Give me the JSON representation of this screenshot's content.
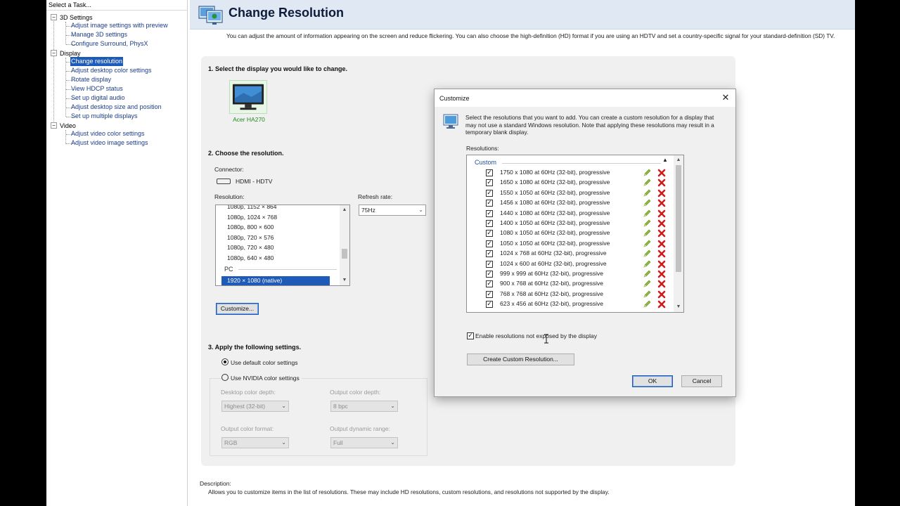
{
  "task_panel": {
    "header": "Select a Task...",
    "categories": [
      {
        "label": "3D Settings",
        "items": [
          "Adjust image settings with preview",
          "Manage 3D settings",
          "Configure Surround, PhysX"
        ]
      },
      {
        "label": "Display",
        "items": [
          "Change resolution",
          "Adjust desktop color settings",
          "Rotate display",
          "View HDCP status",
          "Set up digital audio",
          "Adjust desktop size and position",
          "Set up multiple displays"
        ]
      },
      {
        "label": "Video",
        "items": [
          "Adjust video color settings",
          "Adjust video image settings"
        ]
      }
    ],
    "selected": "Change resolution"
  },
  "page": {
    "title": "Change Resolution",
    "description": "You can adjust the amount of information appearing on the screen and reduce flickering. You can also choose the high-definition (HD) format if you are using an HDTV and set a country-specific signal for your standard-definition (SD) TV.",
    "step1": "1. Select the display you would like to change.",
    "display_name": "Acer HA270",
    "step2": "2. Choose the resolution.",
    "connector_label": "Connector:",
    "connector_value": "HDMI - HDTV",
    "resolution_label": "Resolution:",
    "resolution_items": [
      "1080p, 1152 × 864",
      "1080p, 1024 × 768",
      "1080p, 800 × 600",
      "1080p, 720 × 576",
      "1080p, 720 × 480",
      "1080p, 640 × 480"
    ],
    "resolution_group": "PC",
    "resolution_selected": "1920 × 1080 (native)",
    "refresh_label": "Refresh rate:",
    "refresh_value": "75Hz",
    "customize_button": "Customize...",
    "step3": "3. Apply the following settings.",
    "radio_default": "Use default color settings",
    "radio_nvidia": "Use NVIDIA color settings",
    "desktop_depth_label": "Desktop color depth:",
    "desktop_depth_value": "Highest (32-bit)",
    "output_depth_label": "Output color depth:",
    "output_depth_value": "8 bpc",
    "output_format_label": "Output color format:",
    "output_format_value": "RGB",
    "output_range_label": "Output dynamic range:",
    "output_range_value": "Full",
    "description_title": "Description:",
    "description_text": "Allows you to customize items in the list of resolutions. These may include HD resolutions, custom resolutions, and resolutions not supported by the display."
  },
  "dialog": {
    "title": "Customize",
    "description": "Select the resolutions that you want to add. You can create a custom resolution for a display that may not use a standard Windows resolution. Note that applying these resolutions may result in a temporary blank display.",
    "resolutions_label": "Resolutions:",
    "group": "Custom",
    "resolutions": [
      "1750 x 1080 at 60Hz (32-bit), progressive",
      "1650 x 1080 at 60Hz (32-bit), progressive",
      "1550 x 1050 at 60Hz (32-bit), progressive",
      "1456 x 1080 at 60Hz (32-bit), progressive",
      "1440 x 1080 at 60Hz (32-bit), progressive",
      "1400 x 1050 at 60Hz (32-bit), progressive",
      "1080 x 1050 at 60Hz (32-bit), progressive",
      "1050 x 1050 at 60Hz (32-bit), progressive",
      "1024 x 768 at 60Hz (32-bit), progressive",
      "1024 x 600 at 60Hz (32-bit), progressive",
      "999 x 999 at 60Hz (32-bit), progressive",
      "900 x 768 at 60Hz (32-bit), progressive",
      "768 x 768 at 60Hz (32-bit), progressive",
      "623 x 456 at 60Hz (32-bit), progressive"
    ],
    "enable_label": "Enable resolutions not exposed by the display",
    "create_button": "Create Custom Resolution...",
    "ok_button": "OK",
    "cancel_button": "Cancel"
  },
  "colors": {
    "accent": "#1e5ab8",
    "link": "#1c3d8a",
    "header_bg": "#dfe8f3",
    "delete": "#d01a1a",
    "display_label": "#1e8c1e"
  }
}
